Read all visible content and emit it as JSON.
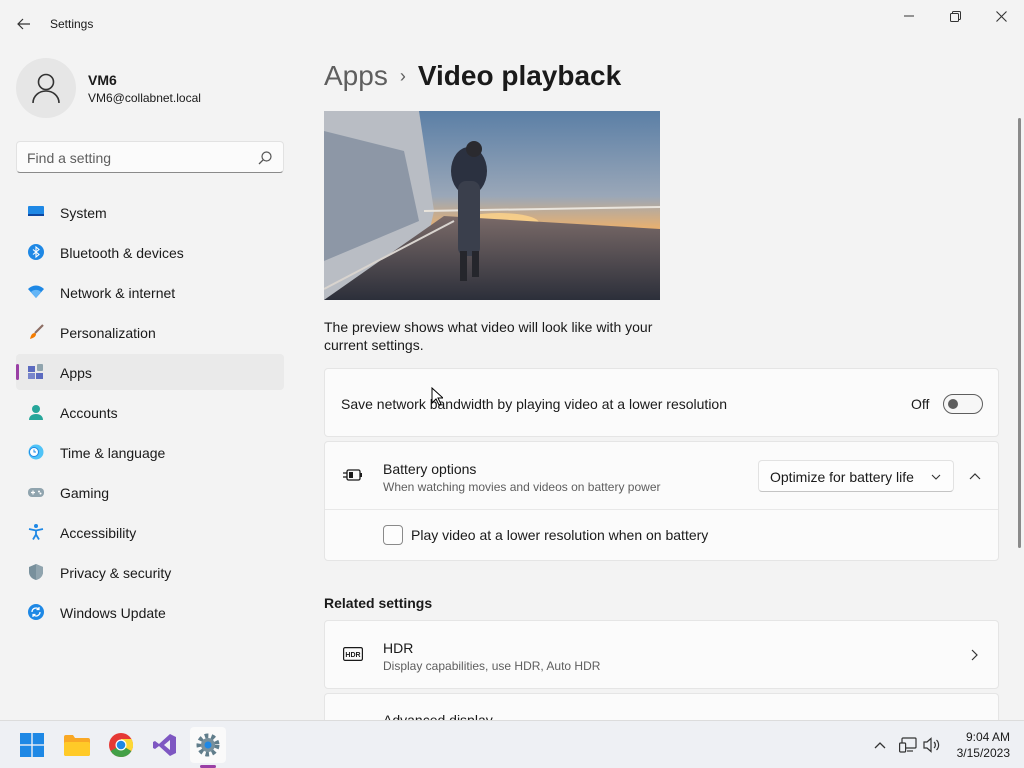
{
  "window": {
    "title": "Settings"
  },
  "profile": {
    "name": "VM6",
    "email": "VM6@collabnet.local"
  },
  "search": {
    "placeholder": "Find a setting"
  },
  "sidebar": {
    "items": [
      {
        "label": "System",
        "icon": "system-icon",
        "active": false
      },
      {
        "label": "Bluetooth & devices",
        "icon": "bluetooth-icon",
        "active": false
      },
      {
        "label": "Network & internet",
        "icon": "wifi-icon",
        "active": false
      },
      {
        "label": "Personalization",
        "icon": "brush-icon",
        "active": false
      },
      {
        "label": "Apps",
        "icon": "apps-icon",
        "active": true
      },
      {
        "label": "Accounts",
        "icon": "accounts-icon",
        "active": false
      },
      {
        "label": "Time & language",
        "icon": "clock-globe-icon",
        "active": false
      },
      {
        "label": "Gaming",
        "icon": "gamepad-icon",
        "active": false
      },
      {
        "label": "Accessibility",
        "icon": "accessibility-icon",
        "active": false
      },
      {
        "label": "Privacy & security",
        "icon": "shield-icon",
        "active": false
      },
      {
        "label": "Windows Update",
        "icon": "update-icon",
        "active": false
      }
    ]
  },
  "breadcrumb": {
    "parent": "Apps",
    "separator": "›",
    "current": "Video playback"
  },
  "main": {
    "preview_description": "The preview shows what video will look like with your current settings.",
    "bandwidth": {
      "label": "Save network bandwidth by playing video at a lower resolution",
      "state_label": "Off",
      "on": false
    },
    "battery": {
      "title": "Battery options",
      "subtitle": "When watching movies and videos on battery power",
      "selected_option": "Optimize for battery life",
      "expanded": true,
      "checkbox_label": "Play video at a lower resolution when on battery",
      "checkbox_checked": false
    },
    "related": {
      "heading": "Related settings",
      "items": [
        {
          "title": "HDR",
          "subtitle": "Display capabilities, use HDR, Auto HDR"
        },
        {
          "title": "Advanced display",
          "subtitle": ""
        }
      ]
    }
  },
  "taskbar": {
    "apps": [
      "start-icon",
      "file-explorer-icon",
      "chrome-icon",
      "visual-studio-icon",
      "settings-icon"
    ],
    "active_app": "settings-icon",
    "time": "9:04 AM",
    "date": "3/15/2023"
  },
  "colors": {
    "accent": "#9a3fa5",
    "background": "#f3f3f3",
    "card": "#fbfbfb"
  }
}
